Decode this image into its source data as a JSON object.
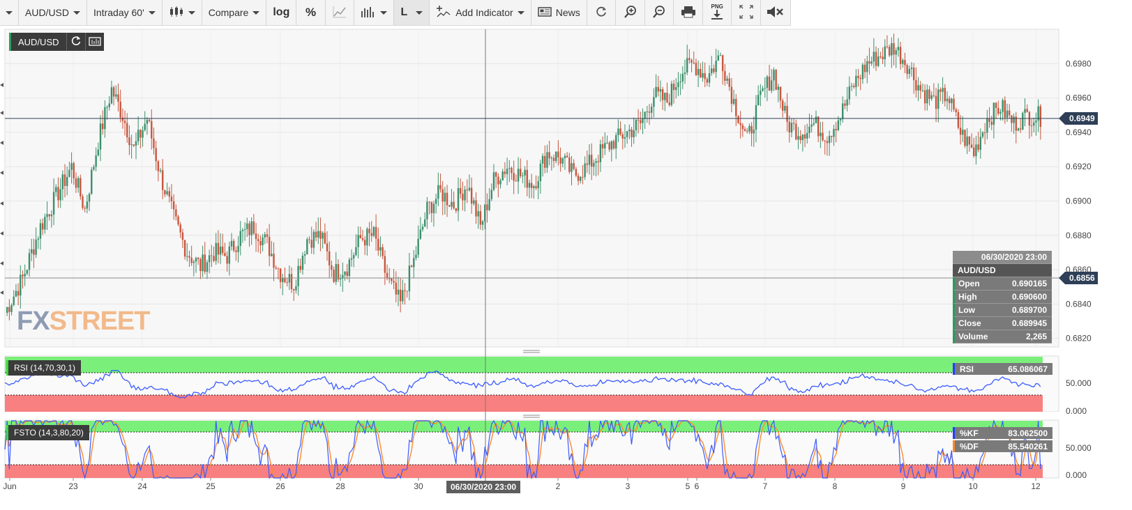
{
  "toolbar": {
    "symbol": "AUD/USD",
    "interval": "Intraday 60'",
    "compare": "Compare",
    "log": "log",
    "percent": "%",
    "line_style": "L",
    "add_indicator": "Add Indicator",
    "news": "News",
    "png_label": "PNG"
  },
  "chart": {
    "symbol_badge": "AUD/USD",
    "logo_fx": "FX",
    "logo_street": "STREET",
    "current_price": "0.6949",
    "crosshair_price": "0.6856",
    "crosshair_date": "06/30/2020 23:00",
    "price_axis": [
      "0.6980",
      "0.6960",
      "0.6940",
      "0.6920",
      "0.6900",
      "0.6880",
      "0.6860",
      "0.6840",
      "0.6820"
    ],
    "date_axis": [
      "Jun",
      "23",
      "24",
      "25",
      "26",
      "28",
      "30",
      "2",
      "3",
      "5",
      "6",
      "7",
      "8",
      "9",
      "10",
      "12"
    ]
  },
  "ohlc_box": {
    "datetime": "06/30/2020 23:00",
    "symbol": "AUD/USD",
    "rows": [
      {
        "label": "Open",
        "value": "0.690165"
      },
      {
        "label": "High",
        "value": "0.690600"
      },
      {
        "label": "Low",
        "value": "0.689700"
      },
      {
        "label": "Close",
        "value": "0.689945"
      },
      {
        "label": "Volume",
        "value": "2,265"
      }
    ]
  },
  "rsi": {
    "label": "RSI (14,70,30,1)",
    "name": "RSI",
    "value": "65.086067",
    "axis": [
      "50.000",
      "0.000"
    ]
  },
  "fsto": {
    "label": "FSTO (14,3,80,20)",
    "kf_name": "%KF",
    "kf_value": "83.062500",
    "df_name": "%DF",
    "df_value": "85.540261",
    "axis": [
      "50.000",
      "0.000"
    ]
  },
  "colors": {
    "up": "#3a8f6b",
    "down": "#c8553d",
    "rsi_line": "#3b5bff",
    "kf_line": "#3b5bff",
    "df_line": "#ff8a2a",
    "overbought": "#7af07a",
    "oversold": "#f98080"
  },
  "chart_data": {
    "type": "candlestick",
    "symbol": "AUD/USD",
    "interval": "60 min",
    "ylim": [
      0.6815,
      0.7
    ],
    "x_ticks": [
      "Jun",
      "23",
      "24",
      "25",
      "26",
      "28",
      "30",
      "2",
      "3",
      "5",
      "6",
      "7",
      "8",
      "9",
      "10",
      "12"
    ],
    "y_ticks": [
      0.682,
      0.684,
      0.686,
      0.688,
      0.69,
      0.692,
      0.694,
      0.696,
      0.698
    ],
    "close_path": [
      [
        0,
        0.6835
      ],
      [
        8,
        0.6855
      ],
      [
        16,
        0.6885
      ],
      [
        24,
        0.6905
      ],
      [
        30,
        0.692
      ],
      [
        36,
        0.6895
      ],
      [
        42,
        0.6935
      ],
      [
        48,
        0.6965
      ],
      [
        53,
        0.695
      ],
      [
        58,
        0.693
      ],
      [
        64,
        0.6948
      ],
      [
        70,
        0.6915
      ],
      [
        76,
        0.689
      ],
      [
        82,
        0.687
      ],
      [
        88,
        0.6862
      ],
      [
        94,
        0.687
      ],
      [
        100,
        0.6868
      ],
      [
        106,
        0.688
      ],
      [
        112,
        0.6885
      ],
      [
        118,
        0.6875
      ],
      [
        124,
        0.6858
      ],
      [
        130,
        0.6852
      ],
      [
        136,
        0.6878
      ],
      [
        142,
        0.688
      ],
      [
        148,
        0.6858
      ],
      [
        154,
        0.6862
      ],
      [
        160,
        0.6878
      ],
      [
        166,
        0.688
      ],
      [
        172,
        0.6855
      ],
      [
        178,
        0.684
      ],
      [
        184,
        0.6865
      ],
      [
        190,
        0.6895
      ],
      [
        196,
        0.6905
      ],
      [
        202,
        0.6898
      ],
      [
        208,
        0.691
      ],
      [
        214,
        0.6885
      ],
      [
        220,
        0.6912
      ],
      [
        226,
        0.692
      ],
      [
        232,
        0.6915
      ],
      [
        238,
        0.691
      ],
      [
        244,
        0.6928
      ],
      [
        250,
        0.6925
      ],
      [
        256,
        0.6915
      ],
      [
        262,
        0.692
      ],
      [
        268,
        0.6928
      ],
      [
        274,
        0.6935
      ],
      [
        280,
        0.694
      ],
      [
        286,
        0.6945
      ],
      [
        292,
        0.6962
      ],
      [
        298,
        0.6958
      ],
      [
        304,
        0.6975
      ],
      [
        310,
        0.698
      ],
      [
        316,
        0.6972
      ],
      [
        322,
        0.6985
      ],
      [
        328,
        0.6958
      ],
      [
        334,
        0.6935
      ],
      [
        340,
        0.696
      ],
      [
        346,
        0.6975
      ],
      [
        352,
        0.6945
      ],
      [
        358,
        0.694
      ],
      [
        364,
        0.6945
      ],
      [
        370,
        0.6938
      ],
      [
        376,
        0.695
      ],
      [
        382,
        0.6968
      ],
      [
        388,
        0.698
      ],
      [
        394,
        0.6985
      ],
      [
        400,
        0.699
      ],
      [
        406,
        0.698
      ],
      [
        412,
        0.6965
      ],
      [
        418,
        0.6958
      ],
      [
        424,
        0.6962
      ],
      [
        430,
        0.694
      ],
      [
        436,
        0.6928
      ],
      [
        442,
        0.6948
      ],
      [
        448,
        0.6955
      ],
      [
        454,
        0.6945
      ],
      [
        460,
        0.695
      ],
      [
        466,
        0.6949
      ]
    ],
    "rsi_last": 65.086067,
    "fsto_kf_last": 83.0625,
    "fsto_df_last": 85.540261,
    "rsi_levels": [
      70,
      30
    ],
    "fsto_levels": [
      80,
      20
    ]
  }
}
